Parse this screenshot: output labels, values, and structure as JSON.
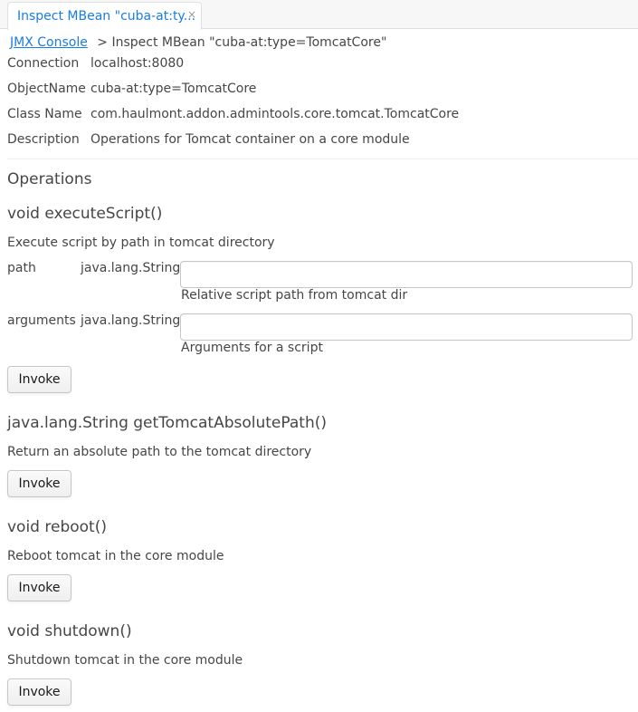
{
  "tab": {
    "title": "Inspect MBean \"cuba-at:ty...",
    "close_glyph": "×"
  },
  "breadcrumb": {
    "link": "JMX Console",
    "current": "> Inspect MBean \"cuba-at:type=TomcatCore\""
  },
  "info": [
    {
      "label": "Connection",
      "value": "localhost:8080"
    },
    {
      "label": "ObjectName",
      "value": "cuba-at:type=TomcatCore"
    },
    {
      "label": "Class Name",
      "value": "com.haulmont.addon.admintools.core.tomcat.TomcatCore"
    },
    {
      "label": "Description",
      "value": "Operations for Tomcat container on a core module"
    }
  ],
  "operations_heading": "Operations",
  "operations": [
    {
      "signature": "void executeScript()",
      "description": "Execute script by path in tomcat directory",
      "params": [
        {
          "name": "path",
          "type": "java.lang.String",
          "value": "",
          "hint": "Relative script path from tomcat dir"
        },
        {
          "name": "arguments",
          "type": "java.lang.String",
          "value": "",
          "hint": "Arguments for a script"
        }
      ],
      "button": "Invoke"
    },
    {
      "signature": "java.lang.String getTomcatAbsolutePath()",
      "description": "Return an absolute path to the tomcat directory",
      "button": "Invoke"
    },
    {
      "signature": "void reboot()",
      "description": "Reboot tomcat in the core module",
      "button": "Invoke"
    },
    {
      "signature": "void shutdown()",
      "description": "Shutdown tomcat in the core module",
      "button": "Invoke"
    }
  ],
  "colors": {
    "accent": "#197de1",
    "text": "#464646"
  }
}
